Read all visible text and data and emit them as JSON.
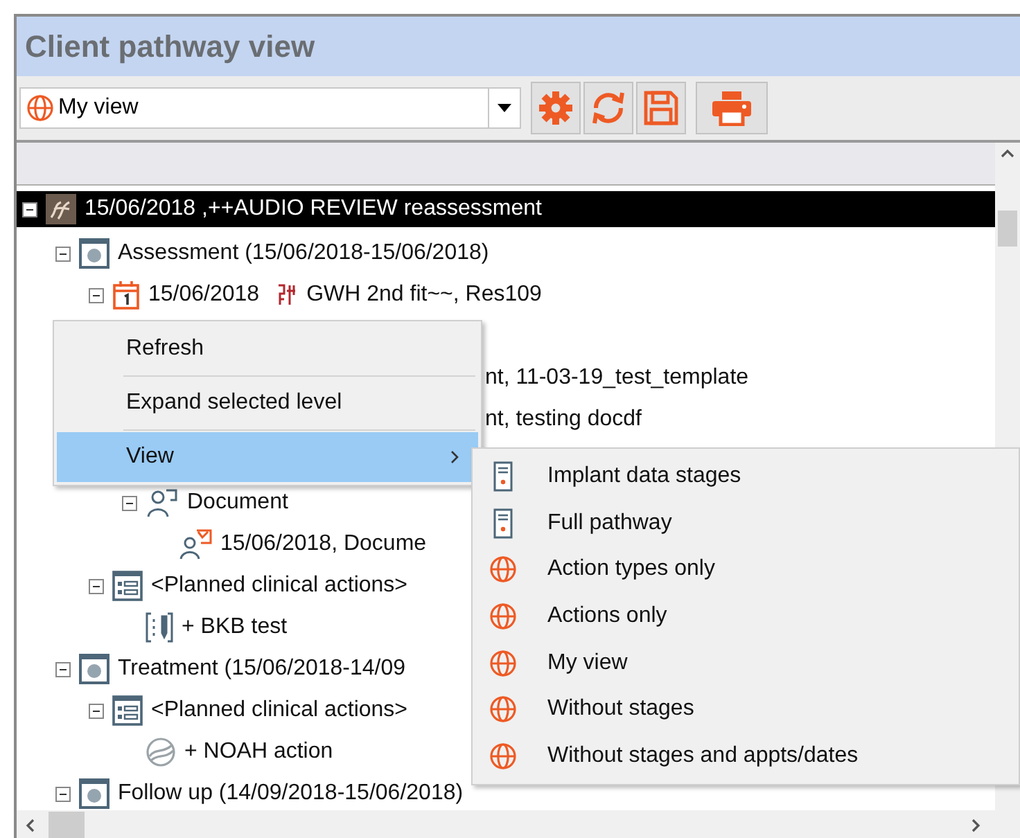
{
  "window": {
    "title": "Client pathway view"
  },
  "toolbar": {
    "view_select": {
      "value": "My view"
    },
    "buttons": [
      {
        "kind": "settings"
      },
      {
        "kind": "refresh"
      },
      {
        "kind": "save"
      },
      {
        "kind": "print"
      }
    ]
  },
  "tree": [
    {
      "kind": "pathway",
      "text": "15/06/2018 ,++AUDIO REVIEW reassessment",
      "selected": true,
      "expanded": true,
      "children": [
        {
          "kind": "stage",
          "text": "Assessment (15/06/2018-15/06/2018)",
          "selected": false,
          "expanded": true,
          "children": [
            {
              "kind": "appointment",
              "date": "15/06/2018",
              "text": "GWH 2nd fit~~, Res109",
              "selected": false,
              "expanded": true,
              "children": [
                {
                  "kind": "covered"
                },
                {
                  "kind": "covered",
                  "text": "nt, 11-03-19_test_template"
                },
                {
                  "kind": "covered",
                  "text": "nt, testing docdf"
                },
                {
                  "kind": "covered"
                },
                {
                  "kind": "document",
                  "text": "Document",
                  "selected": false,
                  "expanded": true,
                  "children": [
                    {
                      "kind": "sent-document",
                      "text": "15/06/2018, Docume",
                      "selected": false
                    }
                  ]
                }
              ]
            },
            {
              "kind": "planned-actions",
              "text": "<Planned clinical actions>",
              "selected": false,
              "expanded": true,
              "children": [
                {
                  "kind": "action",
                  "text": "+ BKB test",
                  "selected": false
                }
              ]
            }
          ]
        },
        {
          "kind": "stage",
          "text": "Treatment (15/06/2018-14/09",
          "selected": false,
          "expanded": true,
          "children": [
            {
              "kind": "planned-actions",
              "text": "<Planned clinical actions>",
              "selected": false,
              "expanded": true,
              "children": [
                {
                  "kind": "noah-action",
                  "text": "+ NOAH action",
                  "selected": false
                }
              ]
            }
          ]
        },
        {
          "kind": "stage",
          "text": "Follow up (14/09/2018-15/06/2018)",
          "selected": false,
          "expanded": true
        }
      ]
    }
  ],
  "context_menu": {
    "items": [
      {
        "label": "Refresh",
        "selected": false,
        "submenu": false
      },
      {
        "label": "Expand selected level",
        "selected": false,
        "submenu": false
      },
      {
        "label": "View",
        "selected": true,
        "submenu": true
      }
    ]
  },
  "submenu": {
    "items": [
      {
        "label": "Implant data stages",
        "kind": "stages"
      },
      {
        "label": "Full pathway",
        "kind": "stages"
      },
      {
        "label": "Action types only",
        "kind": "view"
      },
      {
        "label": "Actions only",
        "kind": "view"
      },
      {
        "label": "My view",
        "kind": "view"
      },
      {
        "label": "Without stages",
        "kind": "view"
      },
      {
        "label": "Without stages and appts/dates",
        "kind": "view"
      }
    ]
  }
}
